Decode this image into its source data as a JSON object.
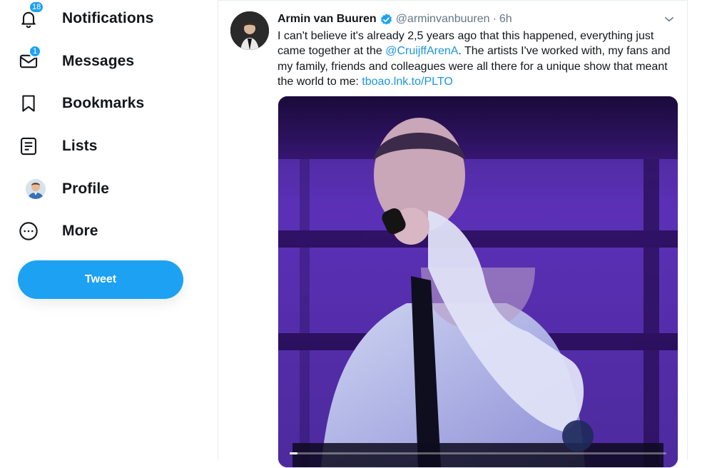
{
  "nav": {
    "items": [
      {
        "label": "Notifications",
        "icon": "bell-icon",
        "badge": "18"
      },
      {
        "label": "Messages",
        "icon": "envelope-icon",
        "badge": "1"
      },
      {
        "label": "Bookmarks",
        "icon": "bookmark-icon"
      },
      {
        "label": "Lists",
        "icon": "list-icon"
      },
      {
        "label": "Profile",
        "icon": "profile-avatar"
      },
      {
        "label": "More",
        "icon": "more-circle-icon"
      }
    ],
    "tweet_button": "Tweet"
  },
  "tweet": {
    "author_name": "Armin van Buuren",
    "verified": true,
    "handle": "@arminvanbuuren",
    "separator": "·",
    "time": "6h",
    "text_parts": {
      "p1": "I can't believe it's already 2,5 years ago that this happened, everything just came together at the ",
      "mention": "@CruijffArenA",
      "p2": ". The artists I've worked with, my fans and my family, friends and colleagues were all there for a unique show that meant the world to me: ",
      "url": "tboao.lnk.to/PLTO"
    },
    "media": {
      "type": "video",
      "progress": 0.02
    }
  },
  "colors": {
    "accent": "#1da1f2",
    "link": "#1b95e0",
    "text": "#14171a",
    "secondary": "#657786"
  }
}
